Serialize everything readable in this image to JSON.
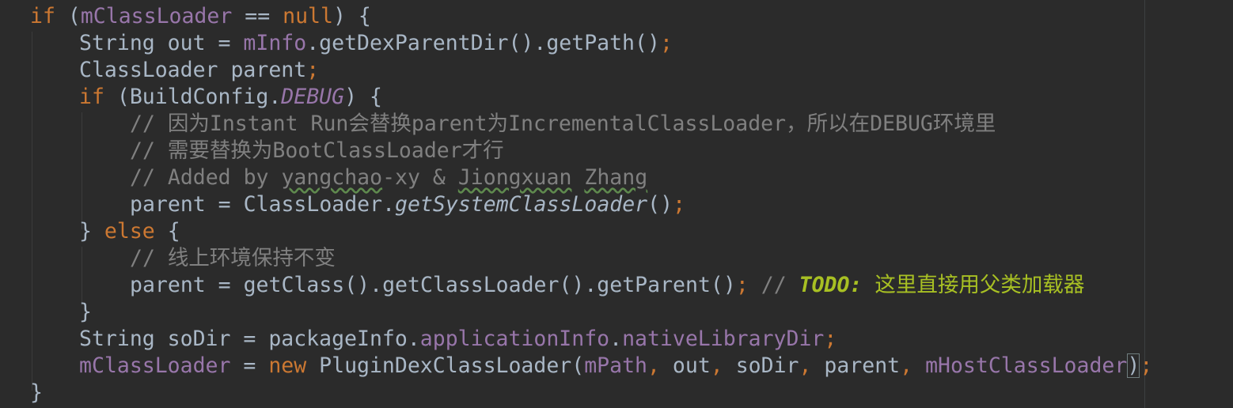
{
  "editor": {
    "colors": {
      "background": "#2b2b2b",
      "keyword": "#cc7832",
      "identifier": "#a9b7c6",
      "field": "#9876aa",
      "comment": "#808080",
      "todo": "#a8c023"
    },
    "lines": [
      {
        "tokens": [
          {
            "t": "if",
            "c": "kw"
          },
          {
            "t": " (",
            "c": "plain"
          },
          {
            "t": "mClassLoader",
            "c": "field"
          },
          {
            "t": " == ",
            "c": "plain"
          },
          {
            "t": "null",
            "c": "kw"
          },
          {
            "t": ") {",
            "c": "plain"
          }
        ]
      },
      {
        "tokens": [
          {
            "t": "String out = ",
            "c": "plain"
          },
          {
            "t": "mInfo",
            "c": "field"
          },
          {
            "t": ".getDexParentDir().getPath()",
            "c": "plain"
          },
          {
            "t": ";",
            "c": "kw"
          }
        ]
      },
      {
        "tokens": [
          {
            "t": "ClassLoader parent",
            "c": "plain"
          },
          {
            "t": ";",
            "c": "kw"
          }
        ]
      },
      {
        "tokens": [
          {
            "t": "if",
            "c": "kw"
          },
          {
            "t": " (BuildConfig.",
            "c": "plain"
          },
          {
            "t": "DEBUG",
            "c": "static"
          },
          {
            "t": ") {",
            "c": "plain"
          }
        ]
      },
      {
        "tokens": [
          {
            "t": "// 因为Instant Run会替换parent为IncrementalClassLoader，所以在DEBUG环境里",
            "c": "comment"
          }
        ]
      },
      {
        "tokens": [
          {
            "t": "// 需要替换为BootClassLoader才行",
            "c": "comment"
          }
        ]
      },
      {
        "tokens": [
          {
            "t": "// Added by ",
            "c": "comment"
          },
          {
            "t": "yangchao",
            "c": "comment",
            "typo": true
          },
          {
            "t": "-xy & ",
            "c": "comment"
          },
          {
            "t": "Jiongxuan",
            "c": "comment",
            "typo": true
          },
          {
            "t": " ",
            "c": "comment"
          },
          {
            "t": "Zhang",
            "c": "comment",
            "typo": true
          }
        ]
      },
      {
        "tokens": [
          {
            "t": "parent = ClassLoader.",
            "c": "plain"
          },
          {
            "t": "getSystemClassLoader",
            "c": "istatic"
          },
          {
            "t": "()",
            "c": "plain"
          },
          {
            "t": ";",
            "c": "kw"
          }
        ]
      },
      {
        "tokens": [
          {
            "t": "} ",
            "c": "plain"
          },
          {
            "t": "else",
            "c": "kw"
          },
          {
            "t": " {",
            "c": "plain"
          }
        ]
      },
      {
        "tokens": [
          {
            "t": "// 线上环境保持不变",
            "c": "comment"
          }
        ]
      },
      {
        "tokens": [
          {
            "t": "parent = getClass().getClassLoader().getParent()",
            "c": "plain"
          },
          {
            "t": ";",
            "c": "kw"
          },
          {
            "t": " // ",
            "c": "comment"
          },
          {
            "t": "TODO:",
            "c": "todo"
          },
          {
            "t": " 这里直接用父类加载器",
            "c": "todotext"
          }
        ]
      },
      {
        "tokens": [
          {
            "t": "}",
            "c": "plain"
          }
        ]
      },
      {
        "tokens": [
          {
            "t": "String soDir = packageInfo.",
            "c": "plain"
          },
          {
            "t": "applicationInfo",
            "c": "field"
          },
          {
            "t": ".",
            "c": "plain"
          },
          {
            "t": "nativeLibraryDir",
            "c": "field"
          },
          {
            "t": ";",
            "c": "kw"
          }
        ]
      },
      {
        "tokens": [
          {
            "t": "mClassLoader",
            "c": "field"
          },
          {
            "t": " = ",
            "c": "plain"
          },
          {
            "t": "new",
            "c": "kw"
          },
          {
            "t": " PluginDexClassLoader(",
            "c": "plain"
          },
          {
            "t": "mPath",
            "c": "field"
          },
          {
            "t": ", ",
            "c": "kw"
          },
          {
            "t": "out",
            "c": "plain"
          },
          {
            "t": ", ",
            "c": "kw"
          },
          {
            "t": "soDir",
            "c": "plain"
          },
          {
            "t": ", ",
            "c": "kw"
          },
          {
            "t": "parent",
            "c": "plain"
          },
          {
            "t": ", ",
            "c": "kw"
          },
          {
            "t": "mHostClassLoader",
            "c": "field"
          },
          {
            "t": ")",
            "c": "plain",
            "caret": true
          },
          {
            "t": ";",
            "c": "kw"
          }
        ]
      },
      {
        "tokens": [
          {
            "t": "}",
            "c": "plain"
          }
        ]
      }
    ]
  }
}
